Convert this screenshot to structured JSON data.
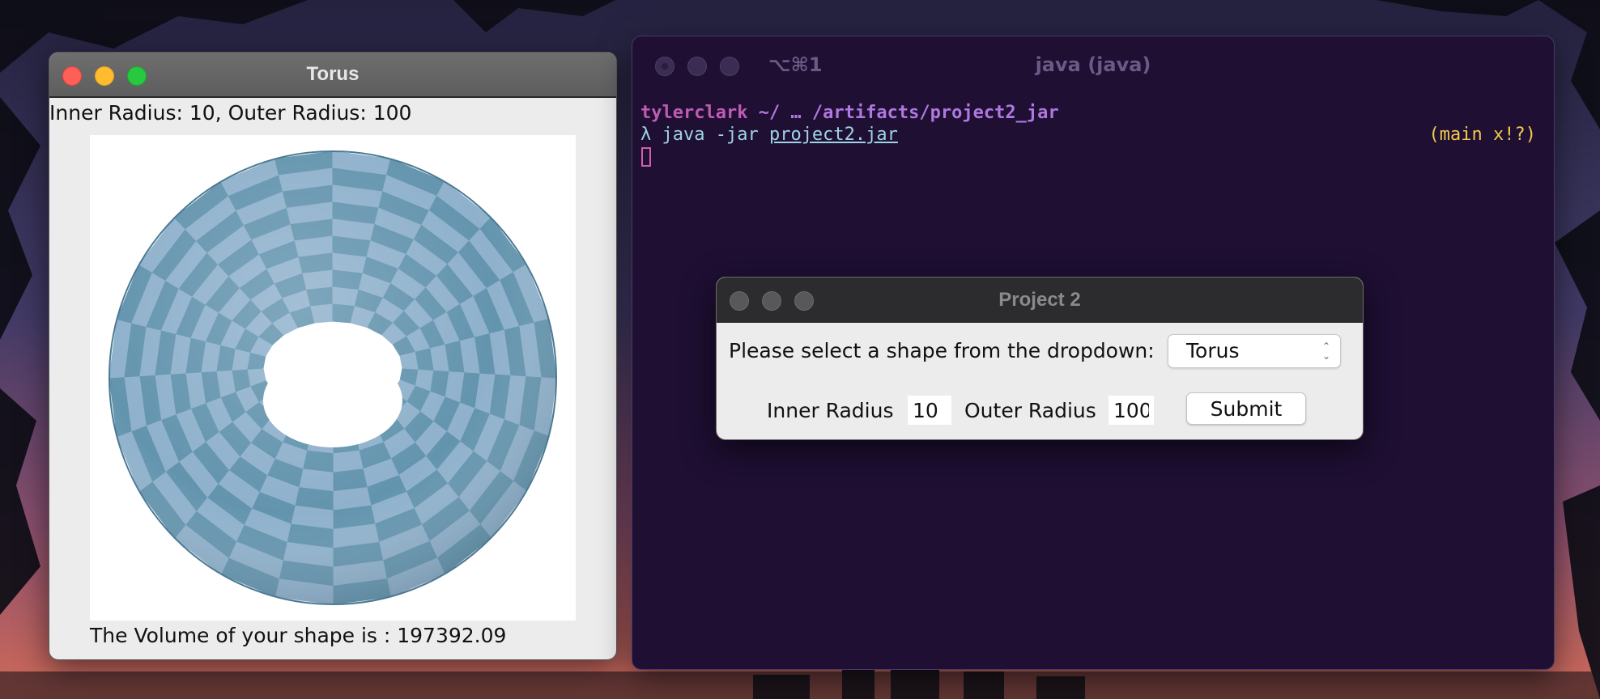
{
  "torus_window": {
    "title": "Torus",
    "info_text": "Inner Radius: 10, Outer Radius: 100",
    "volume_text": "The Volume of your shape is : 197392.09"
  },
  "terminal": {
    "shortcut": "⌥⌘1",
    "title": "java (java)",
    "prompt_user": "tylerclark",
    "prompt_path": " ~/ … /artifacts/project2_jar",
    "lambda": "λ",
    "command": " java -jar ",
    "jar_file": "project2.jar",
    "git_status": "(main x!?)"
  },
  "dialog": {
    "title": "Project 2",
    "prompt": "Please select a shape from the dropdown:",
    "selected_shape": "Torus",
    "inner_radius_label": "Inner Radius",
    "inner_radius_value": "10",
    "outer_radius_label": "Outer Radius",
    "outer_radius_value": "100",
    "submit_label": "Submit"
  },
  "colors": {
    "terminal_bg": "#1e0f33",
    "torus_tile_light": "#8fb1cc",
    "torus_tile_dark": "#6394ae",
    "git_status": "#f2c94c"
  }
}
